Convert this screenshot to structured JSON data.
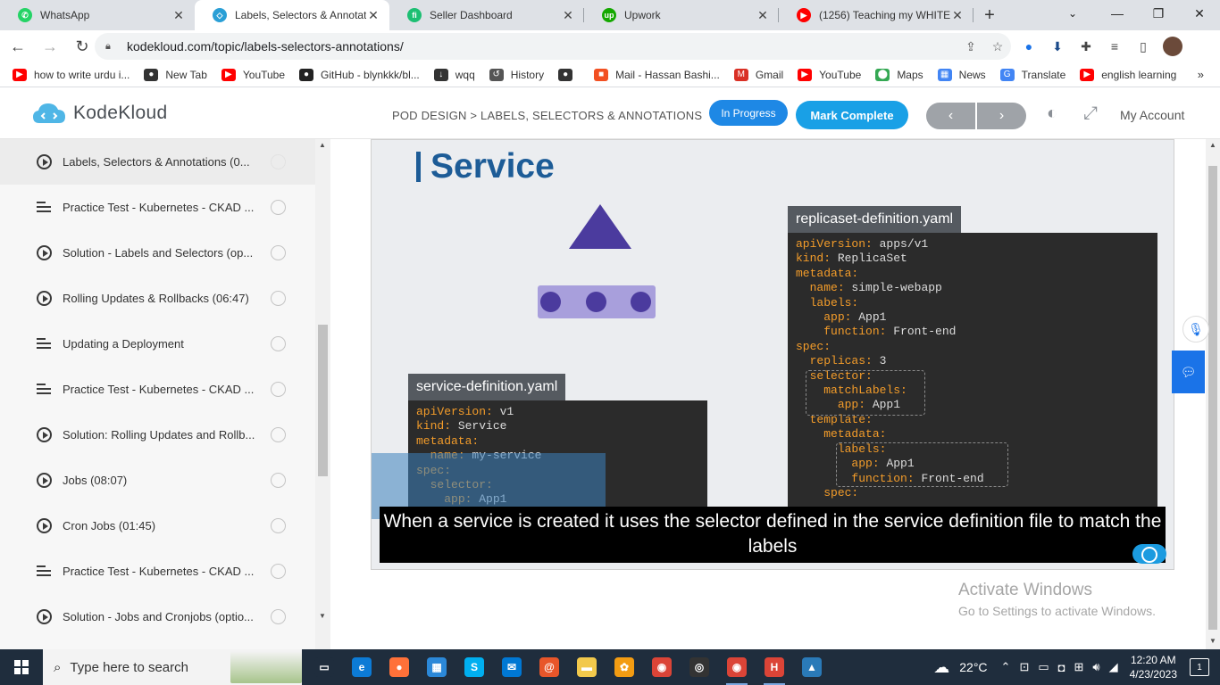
{
  "browser": {
    "tabs": [
      {
        "title": "WhatsApp",
        "icon": "whatsapp-icon",
        "color": "#25d366",
        "glyph": "✆",
        "active": false
      },
      {
        "title": "Labels, Selectors & Annotatic",
        "icon": "kodekloud-icon",
        "color": "#2a9fd6",
        "glyph": "◇",
        "active": true
      },
      {
        "title": "Seller Dashboard",
        "icon": "fiverr-icon",
        "color": "#1dbf73",
        "glyph": "fi",
        "active": false
      },
      {
        "title": "Upwork",
        "icon": "upwork-icon",
        "color": "#14a800",
        "glyph": "up",
        "active": false
      },
      {
        "title": "(1256) Teaching my WHITE fr",
        "icon": "youtube-icon",
        "color": "#ff0000",
        "glyph": "▶",
        "active": false
      }
    ],
    "url": "kodekloud.com/topic/labels-selectors-annotations/",
    "bookmarks": [
      {
        "label": "how to write urdu i...",
        "icon": "youtube-icon",
        "color": "#ff0000",
        "glyph": "▶"
      },
      {
        "label": "New Tab",
        "icon": "globe-icon",
        "color": "#333333",
        "glyph": "●"
      },
      {
        "label": "YouTube",
        "icon": "youtube-icon",
        "color": "#ff0000",
        "glyph": "▶"
      },
      {
        "label": "GitHub - blynkkk/bl...",
        "icon": "github-icon",
        "color": "#222222",
        "glyph": "●"
      },
      {
        "label": "wqq",
        "icon": "download-icon",
        "color": "#333333",
        "glyph": "↓"
      },
      {
        "label": "History",
        "icon": "history-icon",
        "color": "#555555",
        "glyph": "↺"
      },
      {
        "label": "",
        "icon": "globe-icon",
        "color": "#333333",
        "glyph": "●"
      },
      {
        "label": "Mail - Hassan Bashi...",
        "icon": "microsoft-icon",
        "color": "#f25022",
        "glyph": "■"
      },
      {
        "label": "Gmail",
        "icon": "gmail-icon",
        "color": "#d93025",
        "glyph": "M"
      },
      {
        "label": "YouTube",
        "icon": "youtube-icon",
        "color": "#ff0000",
        "glyph": "▶"
      },
      {
        "label": "Maps",
        "icon": "maps-icon",
        "color": "#34a853",
        "glyph": "⬤"
      },
      {
        "label": "News",
        "icon": "news-icon",
        "color": "#4285f4",
        "glyph": "▦"
      },
      {
        "label": "Translate",
        "icon": "translate-icon",
        "color": "#4285f4",
        "glyph": "G"
      },
      {
        "label": "english learning",
        "icon": "youtube-icon",
        "color": "#ff0000",
        "glyph": "▶"
      }
    ]
  },
  "header": {
    "logo_text": "KodeKloud",
    "breadcrumb": "POD DESIGN > LABELS, SELECTORS & ANNOTATIONS",
    "status": "In Progress",
    "complete_label": "Mark Complete",
    "prev": "‹",
    "next": "›",
    "account": "My Account"
  },
  "lessons": [
    {
      "type": "video",
      "title": "Labels, Selectors & Annotations (0...",
      "active": true
    },
    {
      "type": "quiz",
      "title": "Practice Test - Kubernetes - CKAD ...",
      "active": false
    },
    {
      "type": "video",
      "title": "Solution - Labels and Selectors (op...",
      "active": false
    },
    {
      "type": "video",
      "title": "Rolling Updates & Rollbacks (06:47)",
      "active": false
    },
    {
      "type": "quiz",
      "title": "Updating a Deployment",
      "active": false
    },
    {
      "type": "quiz",
      "title": "Practice Test - Kubernetes - CKAD ...",
      "active": false
    },
    {
      "type": "video",
      "title": "Solution: Rolling Updates and Rollb...",
      "active": false
    },
    {
      "type": "video",
      "title": "Jobs (08:07)",
      "active": false
    },
    {
      "type": "video",
      "title": "Cron Jobs (01:45)",
      "active": false
    },
    {
      "type": "quiz",
      "title": "Practice Test - Kubernetes - CKAD ...",
      "active": false
    },
    {
      "type": "video",
      "title": "Solution - Jobs and Cronjobs (optio...",
      "active": false
    }
  ],
  "slide": {
    "title": "Service",
    "replicaset_file": "replicaset-definition.yaml",
    "service_file": "service-definition.yaml",
    "replicaset_yaml": [
      [
        {
          "k": "apiVersion:"
        },
        {
          "v": " apps/v1"
        }
      ],
      [
        {
          "k": "kind:"
        },
        {
          "v": " ReplicaSet"
        }
      ],
      [
        {
          "k": "metadata:"
        }
      ],
      [
        {
          "v": "  "
        },
        {
          "k": "name:"
        },
        {
          "v": " simple-webapp"
        }
      ],
      [
        {
          "v": "  "
        },
        {
          "k": "labels:"
        }
      ],
      [
        {
          "v": "    "
        },
        {
          "k": "app:"
        },
        {
          "v": " App1"
        }
      ],
      [
        {
          "v": "    "
        },
        {
          "k": "function:"
        },
        {
          "v": " Front-end"
        }
      ],
      [
        {
          "k": "spec:"
        }
      ],
      [
        {
          "v": "  "
        },
        {
          "k": "replicas:"
        },
        {
          "v": " 3"
        }
      ],
      [
        {
          "v": "  "
        },
        {
          "k": "selector:"
        }
      ],
      [
        {
          "v": "    "
        },
        {
          "k": "matchLabels:"
        }
      ],
      [
        {
          "v": "      "
        },
        {
          "k": "app:"
        },
        {
          "v": " App1"
        }
      ],
      [
        {
          "v": "  "
        },
        {
          "k": "template:"
        }
      ],
      [
        {
          "v": "    "
        },
        {
          "k": "metadata:"
        }
      ],
      [
        {
          "v": "      "
        },
        {
          "k": "labels:"
        }
      ],
      [
        {
          "v": "        "
        },
        {
          "k": "app:"
        },
        {
          "v": " App1"
        }
      ],
      [
        {
          "v": "        "
        },
        {
          "k": "function:"
        },
        {
          "v": " Front-end"
        }
      ],
      [
        {
          "v": "    "
        },
        {
          "k": "spec:"
        }
      ]
    ],
    "service_yaml": [
      [
        {
          "k": "apiVersion:"
        },
        {
          "v": " v1"
        }
      ],
      [
        {
          "k": "kind:"
        },
        {
          "v": " Service"
        }
      ],
      [
        {
          "k": "metadata:"
        }
      ],
      [
        {
          "v": "  "
        },
        {
          "k": "name:"
        },
        {
          "v": " my-service"
        }
      ],
      [
        {
          "k": "spec:"
        }
      ],
      [
        {
          "v": "  "
        },
        {
          "k": "selector:"
        }
      ],
      [
        {
          "v": "    "
        },
        {
          "k": "app:"
        },
        {
          "v": " App1"
        }
      ]
    ],
    "caption": "When a service is created it uses the selector defined in the service definition file to match the labels"
  },
  "watermark": {
    "line1": "Activate Windows",
    "line2": "Go to Settings to activate Windows."
  },
  "taskbar": {
    "search_placeholder": "Type here to search",
    "apps": [
      {
        "icon": "task-view-icon",
        "color": "#1f2d3d",
        "glyph": "▭",
        "active": false
      },
      {
        "icon": "edge-icon",
        "color": "#0c7bd6",
        "glyph": "e",
        "active": false
      },
      {
        "icon": "firefox-icon",
        "color": "#ff7139",
        "glyph": "●",
        "active": false
      },
      {
        "icon": "store-icon",
        "color": "#2b88d8",
        "glyph": "▦",
        "active": false
      },
      {
        "icon": "skype-icon",
        "color": "#00aff0",
        "glyph": "S",
        "active": false
      },
      {
        "icon": "mail-icon",
        "color": "#0078d4",
        "glyph": "✉",
        "active": false
      },
      {
        "icon": "snail-icon",
        "color": "#e8562a",
        "glyph": "@",
        "active": false
      },
      {
        "icon": "file-explorer-icon",
        "color": "#f2c94c",
        "glyph": "▬",
        "active": false
      },
      {
        "icon": "settings-app-icon",
        "color": "#f39c12",
        "glyph": "✿",
        "active": false
      },
      {
        "icon": "chrome-icon",
        "color": "#db4437",
        "glyph": "◉",
        "active": false
      },
      {
        "icon": "obs-icon",
        "color": "#333333",
        "glyph": "◎",
        "active": false
      },
      {
        "icon": "chrome-profile-icon",
        "color": "#db4437",
        "glyph": "◉",
        "active": true
      },
      {
        "icon": "chrome-h-icon",
        "color": "#db4437",
        "glyph": "H",
        "active": true
      },
      {
        "icon": "photos-icon",
        "color": "#2a7ab8",
        "glyph": "▲",
        "active": false
      }
    ],
    "temperature": "22°C",
    "time": "12:20 AM",
    "date": "4/23/2023"
  }
}
